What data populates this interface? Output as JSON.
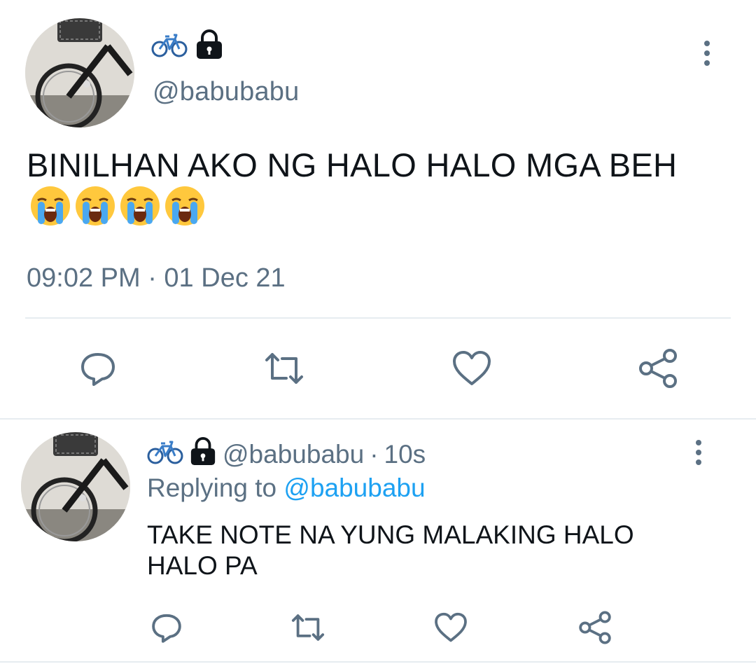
{
  "main_tweet": {
    "display_name_emoji": "bicycle-emoji",
    "protected_icon": "lock-icon",
    "handle": "@babubabu",
    "text": "BINILHAN AKO NG HALO HALO MGA BEH",
    "text_emojis": [
      "loudly-crying-face",
      "loudly-crying-face",
      "loudly-crying-face",
      "loudly-crying-face"
    ],
    "timestamp": "09:02 PM · 01 Dec 21",
    "actions": [
      "reply-icon",
      "retweet-icon",
      "like-icon",
      "share-icon"
    ]
  },
  "reply_tweet": {
    "handle": "@babubabu",
    "time_sep": "·",
    "time_ago": "10s",
    "replying_to_label": "Replying to",
    "replying_to_handle": "@babubabu",
    "text": "TAKE NOTE NA YUNG MALAKING HALO HALO PA",
    "actions": [
      "reply-icon",
      "retweet-icon",
      "like-icon",
      "share-icon"
    ]
  },
  "colors": {
    "secondary_text": "#5b7083",
    "primary_text": "#0f1419",
    "mention": "#1da1f2",
    "divider": "#e6ecf0"
  }
}
